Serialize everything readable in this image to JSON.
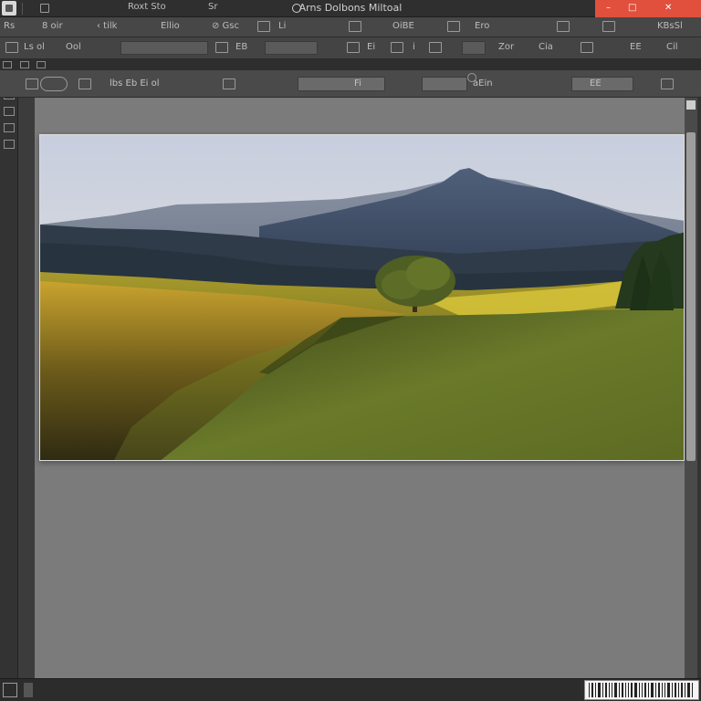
{
  "titlebar": {
    "left_label": "Roxt Sto",
    "small_label": "Sr",
    "title": "Arns Dolbons Miltoal",
    "window_controls": [
      "–",
      "□",
      "✕"
    ],
    "accent_color": "#e0503c"
  },
  "menubar": {
    "items": [
      "Rs",
      "8 oir",
      "‹ tilk",
      "Ellio",
      "⊘ Gsc",
      "Li",
      "OiBE",
      "Ero",
      "KBsSl"
    ]
  },
  "optionsbar": {
    "items": [
      "Ls ol",
      "Ool",
      "EB",
      "Ei",
      "i",
      "Zor",
      "Cia",
      "EE",
      "Cil"
    ]
  },
  "ribbon": {
    "items": [
      "lbs Eb Ei ol",
      "Fi",
      "aEin",
      "EE"
    ]
  },
  "icons": {
    "app": "app-icon",
    "menu": "menu-icon",
    "tools": "tool-icon"
  }
}
